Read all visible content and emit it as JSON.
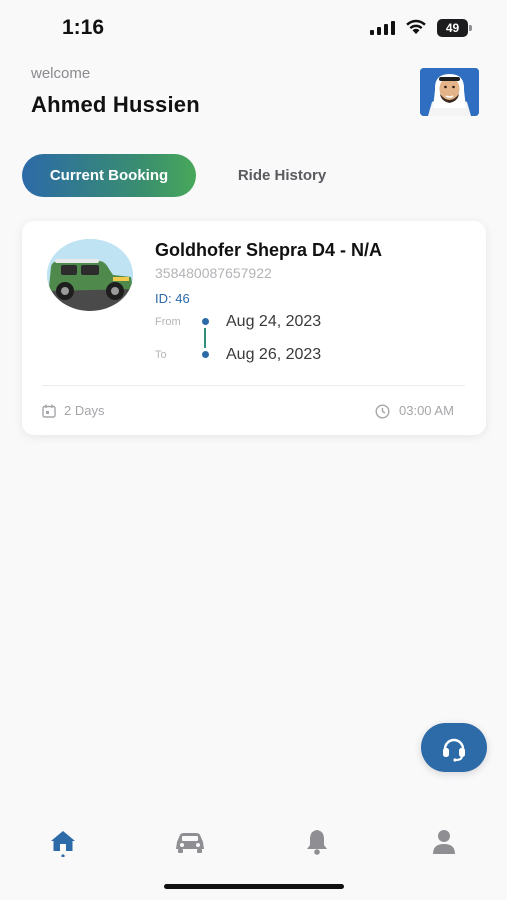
{
  "status_bar": {
    "time": "1:16",
    "battery": "49"
  },
  "header": {
    "welcome": "welcome",
    "user_name": "Ahmed Hussien"
  },
  "tabs": [
    {
      "label": "Current Booking",
      "active": true
    },
    {
      "label": "Ride History",
      "active": false
    }
  ],
  "booking": {
    "title": "Goldhofer Shepra D4 - N/A",
    "serial": "358480087657922",
    "id_label": "ID: 46",
    "from_label": "From",
    "to_label": "To",
    "from_date": "Aug 24, 2023",
    "to_date": "Aug 26, 2023",
    "duration": "2 Days",
    "time": "03:00 AM"
  },
  "icons": {
    "support": "headset-icon",
    "nav": [
      "home-icon",
      "car-icon",
      "bell-icon",
      "user-icon"
    ]
  },
  "colors": {
    "primary": "#2c6aa8",
    "accent_green": "#48a85a",
    "nav_inactive": "#8e8e93"
  }
}
